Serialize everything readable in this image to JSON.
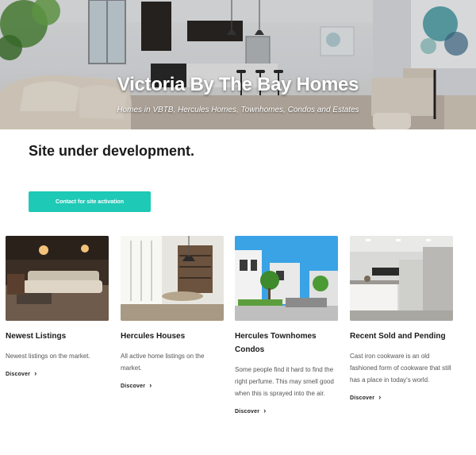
{
  "hero": {
    "title": "Victoria By The Bay Homes",
    "subtitle": "Homes in VBTB, Hercules Homes, Townhomes, Condos and Estates"
  },
  "main": {
    "headline": "Site under development.",
    "cta_label": "Contact for site activation"
  },
  "cards": [
    {
      "title": "Newest Listings",
      "description": "Newest listings on the market.",
      "link_label": "Discover"
    },
    {
      "title": "Hercules Houses",
      "description": "All active home listings on the market.",
      "link_label": "Discover"
    },
    {
      "title": "Hercules Townhomes Condos",
      "description": "Some people find it hard to find the right perfume. This may smell good when this is sprayed into the air.",
      "link_label": "Discover"
    },
    {
      "title": "Recent Sold and Pending",
      "description": "Cast iron cookware is an old fashioned form of cookware that still has a place in today's world.",
      "link_label": "Discover"
    }
  ],
  "colors": {
    "accent": "#1ec9b6",
    "text": "#1a1a1a",
    "muted": "#555555"
  }
}
